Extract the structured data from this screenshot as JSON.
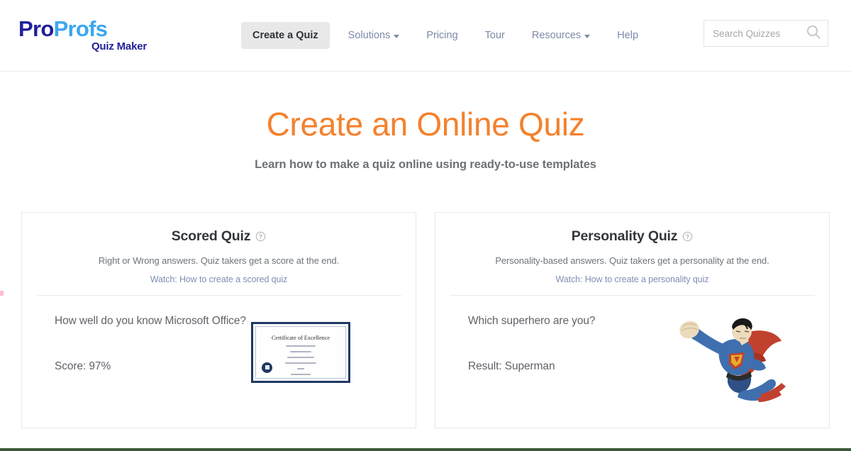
{
  "header": {
    "logo": {
      "part1": "Pro",
      "part2": "Profs",
      "subtitle": "Quiz Maker",
      "color_part1": "#20209b",
      "color_part2": "#3aa7f0"
    },
    "nav": [
      {
        "label": "Create a Quiz",
        "active": true,
        "has_caret": false
      },
      {
        "label": "Solutions",
        "active": false,
        "has_caret": true
      },
      {
        "label": "Pricing",
        "active": false,
        "has_caret": false
      },
      {
        "label": "Tour",
        "active": false,
        "has_caret": false
      },
      {
        "label": "Resources",
        "active": false,
        "has_caret": true
      },
      {
        "label": "Help",
        "active": false,
        "has_caret": false
      }
    ],
    "search": {
      "placeholder": "Search Quizzes",
      "value": "",
      "icon": "search-icon"
    }
  },
  "hero": {
    "title": "Create an Online Quiz",
    "title_color": "#f4812c",
    "subtitle": "Learn how to make a quiz online using ready-to-use templates"
  },
  "cards": [
    {
      "title": "Scored Quiz",
      "help_icon": "question-mark-circle-icon",
      "description": "Right or Wrong answers. Quiz takers get a score at the end.",
      "link": "Watch: How to create a scored quiz",
      "question": "How well do you know Microsoft Office?",
      "result": "Score: 97%",
      "preview": {
        "type": "certificate",
        "title": "Certificate of Excellence",
        "border_color": "#1f3864",
        "seal": "certificate-seal"
      }
    },
    {
      "title": "Personality Quiz",
      "help_icon": "question-mark-circle-icon",
      "description": "Personality-based answers. Quiz takers get a personality at the end.",
      "link": "Watch: How to create a personality quiz",
      "question": "Which superhero are you?",
      "result": "Result: Superman",
      "preview": {
        "type": "superhero-illustration",
        "name": "superman",
        "suit_color": "#3f6fae",
        "cape_color": "#c1412f",
        "emblem_color": "#e9ac2a"
      }
    }
  ]
}
